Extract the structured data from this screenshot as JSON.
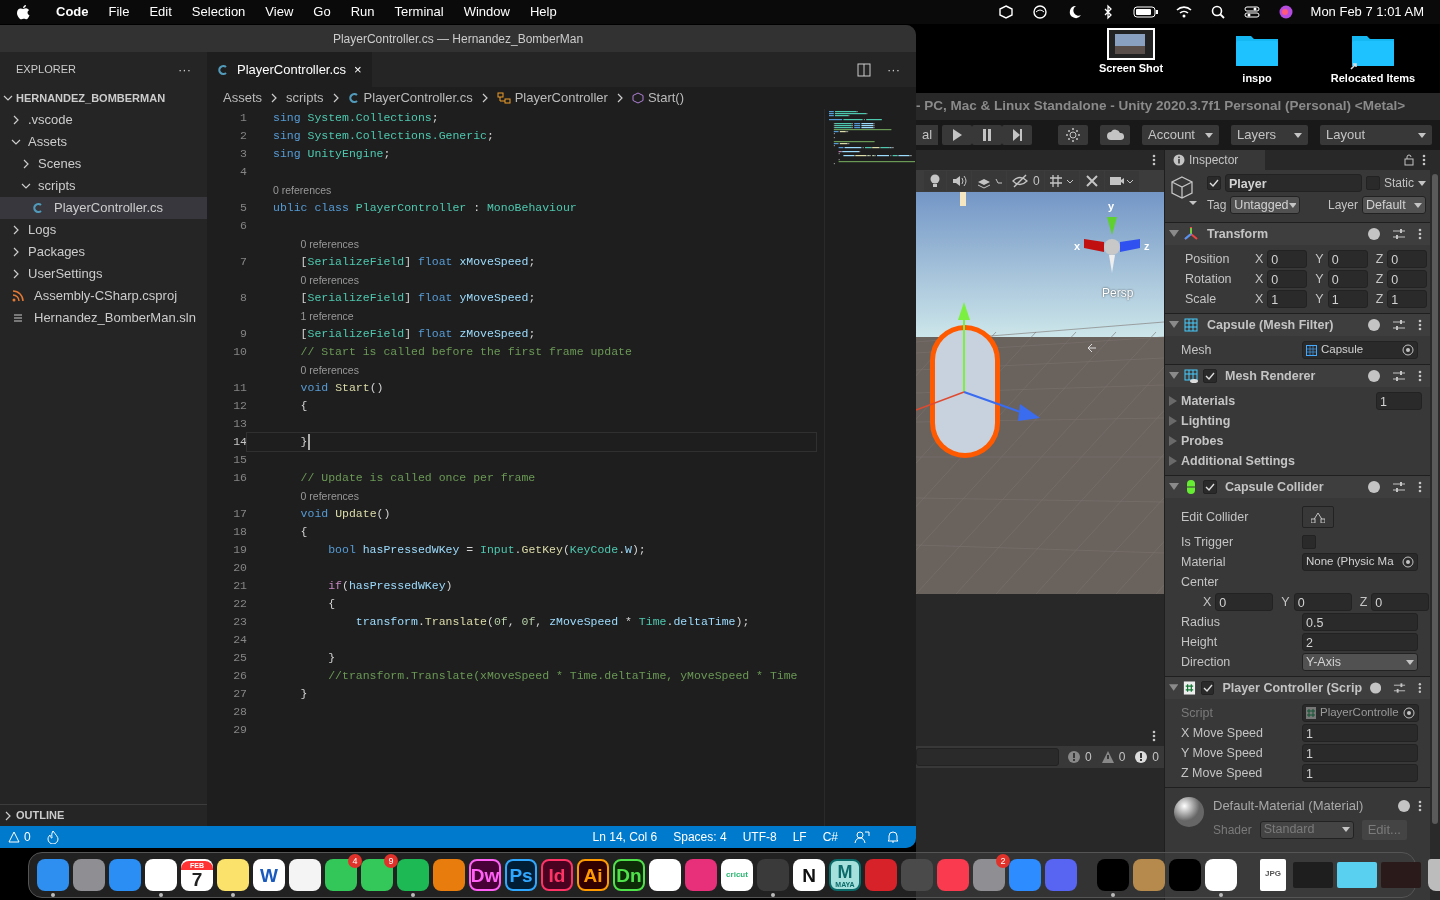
{
  "menu_bar": {
    "items": [
      {
        "label": "Code",
        "kind": "app"
      },
      {
        "label": "File",
        "kind": "menu"
      },
      {
        "label": "Edit",
        "kind": "menu"
      },
      {
        "label": "Selection",
        "kind": "menu"
      },
      {
        "label": "View",
        "kind": "menu"
      },
      {
        "label": "Go",
        "kind": "menu"
      },
      {
        "label": "Run",
        "kind": "menu"
      },
      {
        "label": "Terminal",
        "kind": "menu"
      },
      {
        "label": "Window",
        "kind": "menu"
      },
      {
        "label": "Help",
        "kind": "menu"
      }
    ],
    "clock": "Mon Feb 7  1:01 AM"
  },
  "desktop": {
    "items": [
      {
        "label": "Screen Shot",
        "kind": "screenshot"
      },
      {
        "label": "inspo",
        "kind": "folder"
      },
      {
        "label": "Relocated Items",
        "kind": "alias-folder"
      }
    ]
  },
  "vscode": {
    "title": "PlayerController.cs — Hernandez_BomberMan",
    "explorer": {
      "title": "EXPLORER",
      "more": "···",
      "project": "HERNANDEZ_BOMBERMAN",
      "tree": [
        {
          "label": ".vscode",
          "kind": "folder",
          "expanded": false,
          "selected": false
        },
        {
          "label": "Assets",
          "kind": "folder",
          "expanded": true,
          "selected": false,
          "children": [
            {
              "label": "Scenes",
              "kind": "folder",
              "expanded": false,
              "selected": false
            },
            {
              "label": "scripts",
              "kind": "folder",
              "expanded": true,
              "selected": false,
              "children": [
                {
                  "label": "PlayerController.cs",
                  "kind": "cs",
                  "selected": true
                }
              ]
            }
          ]
        },
        {
          "label": "Logs",
          "kind": "folder",
          "expanded": false,
          "selected": false
        },
        {
          "label": "Packages",
          "kind": "folder",
          "expanded": false,
          "selected": false
        },
        {
          "label": "UserSettings",
          "kind": "folder",
          "expanded": false,
          "selected": false
        },
        {
          "label": "Assembly-CSharp.csproj",
          "kind": "csproj",
          "selected": false
        },
        {
          "label": "Hernandez_BomberMan.sln",
          "kind": "sln",
          "selected": false
        }
      ],
      "outline": "OUTLINE"
    },
    "tab": {
      "label": "PlayerController.cs",
      "close": "×",
      "more": "···"
    },
    "breadcrumbs": [
      {
        "label": "Assets",
        "kind": "folder"
      },
      {
        "label": "scripts",
        "kind": "folder"
      },
      {
        "label": "PlayerController.cs",
        "kind": "cs"
      },
      {
        "label": "PlayerController",
        "kind": "class"
      },
      {
        "label": "Start()",
        "kind": "method"
      }
    ],
    "lines": [
      {
        "number": "1",
        "current": false,
        "tokens": [
          {
            "kind": "keyword",
            "text": "sing "
          },
          {
            "kind": "type",
            "text": "System.Collections"
          },
          {
            "kind": "plain",
            "text": ";"
          }
        ]
      },
      {
        "number": "2",
        "current": false,
        "tokens": [
          {
            "kind": "keyword",
            "text": "sing "
          },
          {
            "kind": "type",
            "text": "System.Collections.Generic"
          },
          {
            "kind": "plain",
            "text": ";"
          }
        ]
      },
      {
        "number": "3",
        "current": false,
        "tokens": [
          {
            "kind": "keyword",
            "text": "sing "
          },
          {
            "kind": "type",
            "text": "UnityEngine"
          },
          {
            "kind": "plain",
            "text": ";"
          }
        ]
      },
      {
        "number": "4",
        "current": false
      },
      {
        "number": "5",
        "current": false,
        "lens": "0 references",
        "tokens": [
          {
            "kind": "keyword",
            "text": "ublic class "
          },
          {
            "kind": "type",
            "text": "PlayerController"
          },
          {
            "kind": "plain",
            "text": " : "
          },
          {
            "kind": "type",
            "text": "MonoBehaviour"
          }
        ]
      },
      {
        "number": "6",
        "current": false
      },
      {
        "number": "7",
        "current": false,
        "lens": "0 references",
        "tokens": [
          {
            "kind": "plain",
            "text": "    ["
          },
          {
            "kind": "type",
            "text": "SerializeField"
          },
          {
            "kind": "plain",
            "text": "] "
          },
          {
            "kind": "keyword",
            "text": "float "
          },
          {
            "kind": "variable",
            "text": "xMoveSpeed"
          },
          {
            "kind": "plain",
            "text": ";"
          }
        ]
      },
      {
        "number": "8",
        "current": false,
        "lens": "0 references",
        "tokens": [
          {
            "kind": "plain",
            "text": "    ["
          },
          {
            "kind": "type",
            "text": "SerializeField"
          },
          {
            "kind": "plain",
            "text": "] "
          },
          {
            "kind": "keyword",
            "text": "float "
          },
          {
            "kind": "variable",
            "text": "yMoveSpeed"
          },
          {
            "kind": "plain",
            "text": ";"
          }
        ]
      },
      {
        "number": "9",
        "current": false,
        "lens": "1 reference",
        "tokens": [
          {
            "kind": "plain",
            "text": "    ["
          },
          {
            "kind": "type",
            "text": "SerializeField"
          },
          {
            "kind": "plain",
            "text": "] "
          },
          {
            "kind": "keyword",
            "text": "float "
          },
          {
            "kind": "variable",
            "text": "zMoveSpeed"
          },
          {
            "kind": "plain",
            "text": ";"
          }
        ]
      },
      {
        "number": "10",
        "current": false,
        "tokens": [
          {
            "kind": "comment",
            "text": "    // Start is called before the first frame update"
          }
        ]
      },
      {
        "number": "11",
        "current": false,
        "lens": "0 references",
        "tokens": [
          {
            "kind": "keyword",
            "text": "    void "
          },
          {
            "kind": "function",
            "text": "Start"
          },
          {
            "kind": "plain",
            "text": "()"
          }
        ]
      },
      {
        "number": "12",
        "current": false,
        "tokens": [
          {
            "kind": "plain",
            "text": "    {"
          }
        ]
      },
      {
        "number": "13",
        "current": false
      },
      {
        "number": "14",
        "current": true,
        "tokens": [
          {
            "kind": "plain",
            "text": "    }"
          }
        ]
      },
      {
        "number": "15",
        "current": false
      },
      {
        "number": "16",
        "current": false,
        "tokens": [
          {
            "kind": "comment",
            "text": "    // Update is called once per frame"
          }
        ]
      },
      {
        "number": "17",
        "current": false,
        "lens": "0 references",
        "tokens": [
          {
            "kind": "keyword",
            "text": "    void "
          },
          {
            "kind": "function",
            "text": "Update"
          },
          {
            "kind": "plain",
            "text": "()"
          }
        ]
      },
      {
        "number": "18",
        "current": false,
        "tokens": [
          {
            "kind": "plain",
            "text": "    {"
          }
        ]
      },
      {
        "number": "19",
        "current": false,
        "tokens": [
          {
            "kind": "keyword",
            "text": "        bool "
          },
          {
            "kind": "variable",
            "text": "hasPressedWKey"
          },
          {
            "kind": "plain",
            "text": " = "
          },
          {
            "kind": "type",
            "text": "Input"
          },
          {
            "kind": "plain",
            "text": "."
          },
          {
            "kind": "function",
            "text": "GetKey"
          },
          {
            "kind": "plain",
            "text": "("
          },
          {
            "kind": "type",
            "text": "KeyCode"
          },
          {
            "kind": "plain",
            "text": "."
          },
          {
            "kind": "variable",
            "text": "W"
          },
          {
            "kind": "plain",
            "text": ");"
          }
        ]
      },
      {
        "number": "20",
        "current": false
      },
      {
        "number": "21",
        "current": false,
        "tokens": [
          {
            "kind": "control",
            "text": "        if"
          },
          {
            "kind": "plain",
            "text": "("
          },
          {
            "kind": "variable",
            "text": "hasPressedWKey"
          },
          {
            "kind": "plain",
            "text": ")"
          }
        ]
      },
      {
        "number": "22",
        "current": false,
        "tokens": [
          {
            "kind": "plain",
            "text": "        {"
          }
        ]
      },
      {
        "number": "23",
        "current": false,
        "tokens": [
          {
            "kind": "variable",
            "text": "            transform"
          },
          {
            "kind": "plain",
            "text": "."
          },
          {
            "kind": "function",
            "text": "Translate"
          },
          {
            "kind": "plain",
            "text": "("
          },
          {
            "kind": "number",
            "text": "0f"
          },
          {
            "kind": "plain",
            "text": ", "
          },
          {
            "kind": "number",
            "text": "0f"
          },
          {
            "kind": "plain",
            "text": ", "
          },
          {
            "kind": "variable",
            "text": "zMoveSpeed"
          },
          {
            "kind": "plain",
            "text": " * "
          },
          {
            "kind": "type",
            "text": "Time"
          },
          {
            "kind": "plain",
            "text": "."
          },
          {
            "kind": "variable",
            "text": "deltaTime"
          },
          {
            "kind": "plain",
            "text": ");"
          }
        ]
      },
      {
        "number": "24",
        "current": false
      },
      {
        "number": "25",
        "current": false,
        "tokens": [
          {
            "kind": "plain",
            "text": "        }"
          }
        ]
      },
      {
        "number": "26",
        "current": false,
        "tokens": [
          {
            "kind": "comment",
            "text": "        //transform.Translate(xMoveSpeed * Time.deltaTime, yMoveSpeed * Time"
          }
        ]
      },
      {
        "number": "27",
        "current": false,
        "tokens": [
          {
            "kind": "plain",
            "text": "    }"
          }
        ]
      },
      {
        "number": "28",
        "current": false
      },
      {
        "number": "29",
        "current": false
      }
    ],
    "status": {
      "problems": "0",
      "items": [
        "Ln 14, Col 6",
        "Spaces: 4",
        "UTF-8",
        "LF",
        "C#"
      ]
    }
  },
  "unity": {
    "title": "- PC, Mac & Linux Standalone - Unity 2020.3.7f1 Personal (Personal) <Metal>",
    "toolbar": {
      "pivot": "al",
      "menus": [
        "Account",
        "Layers",
        "Layout"
      ]
    },
    "scene": {
      "hidden_count": "0",
      "gizmo": {
        "x": "x",
        "y": "y",
        "z": "z"
      },
      "projection": "Persp"
    },
    "console": {
      "counts": [
        {
          "kind": "info",
          "value": "0"
        },
        {
          "kind": "warning",
          "value": "0"
        },
        {
          "kind": "error",
          "value": "0"
        }
      ]
    },
    "inspector": {
      "tab": "Inspector",
      "object": {
        "active": true,
        "name": "Player",
        "static": false,
        "static_label": "Static",
        "tag_label": "Tag",
        "tag": "Untagged",
        "layer_label": "Layer",
        "layer": "Default"
      },
      "components": [
        {
          "title": "Transform",
          "kind": "transform",
          "rows": [
            {
              "kind": "vector3",
              "label": "Position",
              "fields": [
                {
                  "axis": "X",
                  "value": "0"
                },
                {
                  "axis": "Y",
                  "value": "0"
                },
                {
                  "axis": "Z",
                  "value": "0"
                }
              ]
            },
            {
              "kind": "vector3",
              "label": "Rotation",
              "fields": [
                {
                  "axis": "X",
                  "value": "0"
                },
                {
                  "axis": "Y",
                  "value": "0"
                },
                {
                  "axis": "Z",
                  "value": "0"
                }
              ]
            },
            {
              "kind": "vector3",
              "label": "Scale",
              "fields": [
                {
                  "axis": "X",
                  "value": "1"
                },
                {
                  "axis": "Y",
                  "value": "1"
                },
                {
                  "axis": "Z",
                  "value": "1"
                }
              ]
            }
          ]
        },
        {
          "title": "Capsule (Mesh Filter)",
          "kind": "meshfilter",
          "rows": [
            {
              "kind": "object",
              "label": "Mesh",
              "value": "Capsule"
            }
          ]
        },
        {
          "title": "Mesh Renderer",
          "kind": "meshrenderer",
          "enabled": true,
          "rows": [
            {
              "kind": "foldout",
              "label": "Materials",
              "value": "1"
            },
            {
              "kind": "foldout",
              "label": "Lighting"
            },
            {
              "kind": "foldout",
              "label": "Probes"
            },
            {
              "kind": "foldout",
              "label": "Additional Settings"
            }
          ]
        },
        {
          "title": "Capsule Collider",
          "kind": "collider",
          "enabled": true,
          "rows": [
            {
              "kind": "button",
              "label": "Edit Collider"
            },
            {
              "kind": "checkbox",
              "label": "Is Trigger",
              "checked": false
            },
            {
              "kind": "object",
              "label": "Material",
              "value": "None (Physic Ma"
            },
            {
              "kind": "heading",
              "label": "Center"
            },
            {
              "kind": "vector3-inline",
              "fields": [
                {
                  "axis": "X",
                  "value": "0"
                },
                {
                  "axis": "Y",
                  "value": "0"
                },
                {
                  "axis": "Z",
                  "value": "0"
                }
              ]
            },
            {
              "kind": "number",
              "label": "Radius",
              "value": "0.5"
            },
            {
              "kind": "number",
              "label": "Height",
              "value": "2"
            },
            {
              "kind": "dropdown",
              "label": "Direction",
              "value": "Y-Axis"
            }
          ]
        },
        {
          "title": "Player Controller (Scrip",
          "kind": "script",
          "enabled": true,
          "rows": [
            {
              "kind": "script",
              "label": "Script",
              "value": "PlayerControlle"
            },
            {
              "kind": "number",
              "label": "X Move Speed",
              "value": "1"
            },
            {
              "kind": "number",
              "label": "Y Move Speed",
              "value": "1"
            },
            {
              "kind": "number",
              "label": "Z Move Speed",
              "value": "1"
            }
          ]
        }
      ],
      "material": {
        "name": "Default-Material (Material)",
        "shader_label": "Shader",
        "shader": "Standard",
        "edit": "Edit..."
      }
    }
  },
  "dock": [
    {
      "kind": "app",
      "color": "#2f8ff0",
      "running": true
    },
    {
      "kind": "app",
      "color": "#8e8e93",
      "running": false
    },
    {
      "kind": "app",
      "color": "#2a8ef5",
      "running": false
    },
    {
      "kind": "app",
      "color": "#ffffff",
      "running": true
    },
    {
      "kind": "calendar",
      "color": "#ffffff",
      "header": "FEB",
      "label": {
        "text": "7",
        "color": "#222222"
      },
      "running": false
    },
    {
      "kind": "app",
      "color": "#fbe26b",
      "running": true
    },
    {
      "kind": "app",
      "color": "#ffffff",
      "label": {
        "text": "W",
        "color": "#185abd"
      },
      "running": false
    },
    {
      "kind": "app",
      "color": "#f4f4f4",
      "running": false
    },
    {
      "kind": "app",
      "color": "#33c759",
      "badge": "4",
      "running": false
    },
    {
      "kind": "app",
      "color": "#34c759",
      "badge": "9",
      "running": false
    },
    {
      "kind": "app",
      "color": "#1db954",
      "running": true
    },
    {
      "kind": "app",
      "color": "#e87d0d",
      "running": false
    },
    {
      "kind": "app",
      "color": "#470137",
      "label": {
        "text": "Dw",
        "color": "#ff61f6"
      },
      "running": false
    },
    {
      "kind": "app",
      "color": "#001e36",
      "label": {
        "text": "Ps",
        "color": "#31a8ff"
      },
      "running": false
    },
    {
      "kind": "app",
      "color": "#49021f",
      "label": {
        "text": "Id",
        "color": "#ff3366"
      },
      "running": false
    },
    {
      "kind": "app",
      "color": "#330000",
      "label": {
        "text": "Ai",
        "color": "#ff9a00"
      },
      "running": false
    },
    {
      "kind": "app",
      "color": "#0d2b06",
      "label": {
        "text": "Dn",
        "color": "#4fe24a"
      },
      "running": false
    },
    {
      "kind": "app",
      "color": "#ffffff",
      "running": false
    },
    {
      "kind": "app",
      "color": "#e8307a",
      "running": false
    },
    {
      "kind": "app",
      "color": "#ffffff",
      "label": {
        "text": "cricut",
        "color": "#2bb673"
      },
      "running": false
    },
    {
      "kind": "app",
      "color": "#3a3a3a",
      "running": true
    },
    {
      "kind": "app",
      "color": "#ffffff",
      "label": {
        "text": "N",
        "color": "#111111"
      },
      "running": false
    },
    {
      "kind": "app",
      "color": "#a5e0dc",
      "label": {
        "text": "M",
        "color": "#0b6a6a"
      },
      "sublabel": "MAYA",
      "running": false
    },
    {
      "kind": "app",
      "color": "#d8222a",
      "running": false
    },
    {
      "kind": "app",
      "color": "#4a4a4a",
      "running": false
    },
    {
      "kind": "app",
      "color": "#fa3b4f",
      "running": false
    },
    {
      "kind": "app",
      "color": "#8e8e93",
      "badge": "2",
      "running": false
    },
    {
      "kind": "app",
      "color": "#2d8cff",
      "running": false
    },
    {
      "kind": "app",
      "color": "#5865f2",
      "running": false
    },
    {
      "kind": "separator"
    },
    {
      "kind": "app",
      "color": "#000000",
      "running": true
    },
    {
      "kind": "app",
      "color": "#b68a4c",
      "running": false
    },
    {
      "kind": "app",
      "color": "#000000",
      "running": false
    },
    {
      "kind": "app",
      "color": "#ffffff",
      "running": true
    },
    {
      "kind": "separator"
    },
    {
      "kind": "file",
      "color": "#ffffff",
      "label": {
        "text": "JPG",
        "color": "#555555"
      }
    },
    {
      "kind": "thumb",
      "color": "#1e1e1e"
    },
    {
      "kind": "thumb",
      "color": "#5ad0f0"
    },
    {
      "kind": "thumb",
      "color": "#2a1a1a"
    },
    {
      "kind": "trash",
      "color": "#bcbcbc"
    }
  ]
}
